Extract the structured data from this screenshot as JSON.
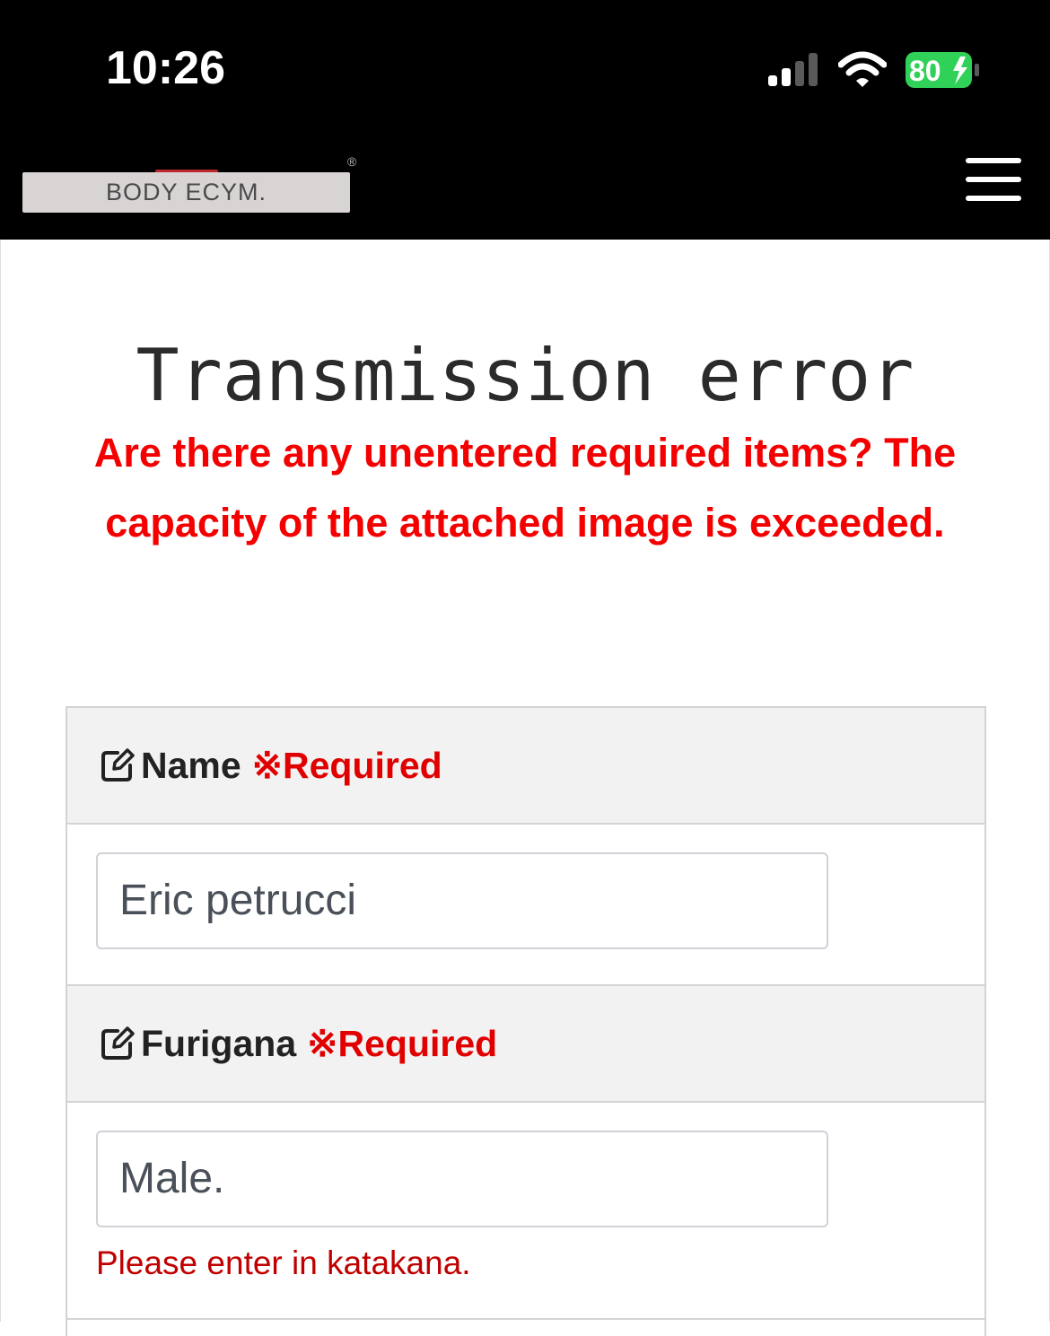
{
  "status_bar": {
    "time": "10:26",
    "battery_level": "80",
    "icons": [
      "signal-icon",
      "wifi-icon",
      "battery-charging-icon"
    ]
  },
  "header": {
    "logo_text": "BODY ECYM.",
    "registered_mark": "®",
    "menu_icon": "hamburger-menu-icon"
  },
  "page": {
    "title": "Transmission error",
    "error_message": "Are there any unentered required items? The capacity of the attached image is exceeded."
  },
  "form": {
    "fields": [
      {
        "label": "Name",
        "required_label": "※Required",
        "value": "Eric petrucci",
        "icon": "edit-icon"
      },
      {
        "label": "Furigana",
        "required_label": "※Required",
        "value": "Male.",
        "hint": "Please enter in katakana.",
        "icon": "edit-icon"
      }
    ]
  },
  "colors": {
    "error_red": "#f40000",
    "header_bg": "#000000",
    "field_header_bg": "#f2f2f2"
  }
}
